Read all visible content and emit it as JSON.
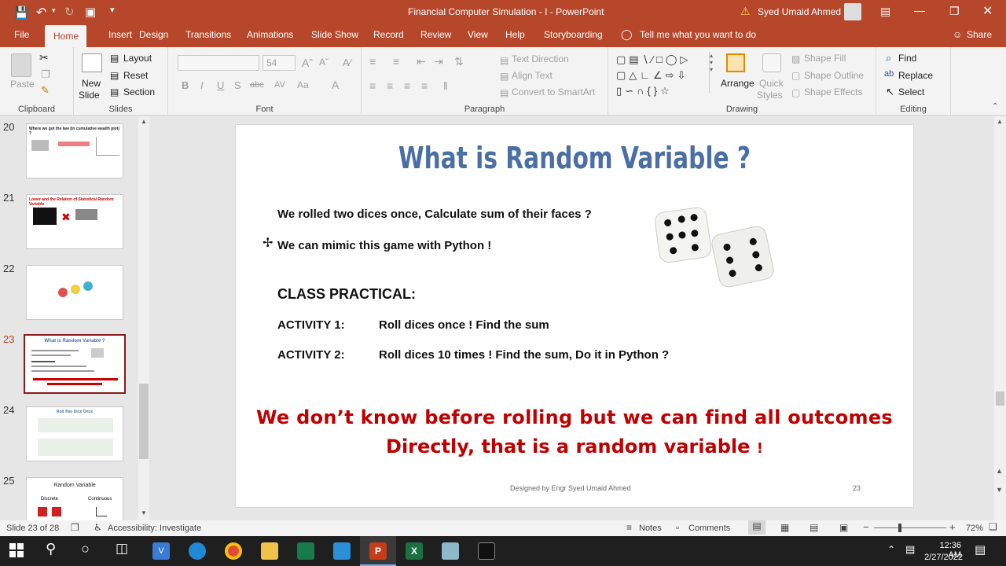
{
  "window": {
    "title": "Financial Computer Simulation - I  -  PowerPoint",
    "user": "Syed Umaid Ahmed"
  },
  "tabs": [
    "File",
    "Home",
    "Insert",
    "Design",
    "Transitions",
    "Animations",
    "Slide Show",
    "Record",
    "Review",
    "View",
    "Help",
    "Storyboarding"
  ],
  "tell_me": "Tell me what you want to do",
  "share": "Share",
  "ribbon": {
    "clipboard": {
      "paste": "Paste",
      "label": "Clipboard"
    },
    "slides": {
      "new_slide": "New",
      "new_slide2": "Slide",
      "layout": "Layout",
      "reset": "Reset",
      "section": "Section",
      "label": "Slides"
    },
    "font": {
      "size": "54",
      "label": "Font"
    },
    "paragraph": {
      "text_direction": "Text Direction",
      "align_text": "Align Text",
      "smartart": "Convert to SmartArt",
      "label": "Paragraph"
    },
    "drawing": {
      "arrange": "Arrange",
      "quick_styles": "Quick",
      "quick_styles2": "Styles",
      "shape_fill": "Shape Fill",
      "shape_outline": "Shape Outline",
      "shape_effects": "Shape Effects",
      "label": "Drawing"
    },
    "editing": {
      "find": "Find",
      "replace": "Replace",
      "select": "Select",
      "label": "Editing"
    }
  },
  "thumbnails": [
    {
      "num": "20",
      "title": "Where we got the law (In cumulative wealth plot) ?"
    },
    {
      "num": "21",
      "title": "Lower and the Relation of Statistical Random Variable"
    },
    {
      "num": "22",
      "title": ""
    },
    {
      "num": "23",
      "title": "What is Random Variable ?"
    },
    {
      "num": "24",
      "title": "Roll Two Dice Once"
    },
    {
      "num": "25",
      "title": "Random Variable",
      "discrete": "Discrete",
      "continuous": "Continuous"
    }
  ],
  "slide": {
    "title": "What is Random Variable ?",
    "line1": "We rolled two dices once, Calculate sum of their faces ?",
    "line2": "We can mimic this game with Python !",
    "practical": "CLASS PRACTICAL:",
    "activity1_label": "ACTIVITY 1:",
    "activity1_text": "Roll dices once ! Find the sum",
    "activity2_label": "ACTIVITY 2:",
    "activity2_text": "Roll dices 10 times ! Find the sum, Do it in Python ?",
    "highlight1": "We don’t know before rolling but we can find all outcomes",
    "highlight2": "Directly, that is a random variable",
    "highlight2_end": "!",
    "footer": "Designed by Engr Syed Umaid Ahmed",
    "page": "23"
  },
  "status": {
    "slide": "Slide 23 of 28",
    "accessibility": "Accessibility: Investigate",
    "notes": "Notes",
    "comments": "Comments",
    "zoom": "72%"
  },
  "taskbar": {
    "time": "12:36 AM",
    "date": "2/27/2022"
  },
  "colors": {
    "accent": "#b7472a",
    "slide_title": "#4a6fa5",
    "highlight": "#c00000"
  }
}
